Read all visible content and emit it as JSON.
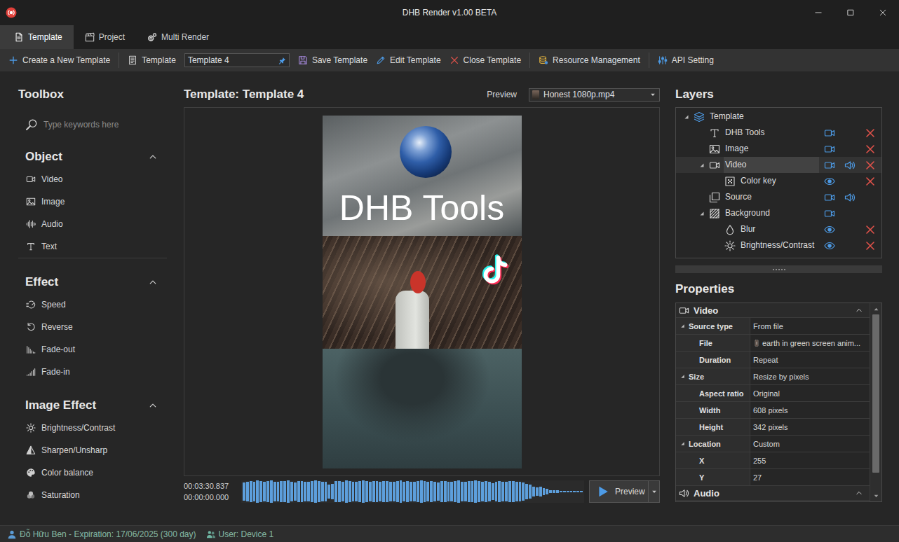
{
  "window": {
    "title": "DHB Render v1.00 BETA"
  },
  "tabs": [
    {
      "label": "Template",
      "selected": true
    },
    {
      "label": "Project",
      "selected": false
    },
    {
      "label": "Multi Render",
      "selected": false
    }
  ],
  "toolbar": {
    "create_button": "Create a New Template",
    "template_label": "Template",
    "template_field": "Template 4",
    "save_button": "Save Template",
    "edit_button": "Edit Template",
    "close_button": "Close Template",
    "resource_button": "Resource Management",
    "api_button": "API Setting"
  },
  "toolbox": {
    "title": "Toolbox",
    "search_placeholder": "Type keywords here",
    "sections": [
      {
        "title": "Object",
        "expanded": true,
        "items": [
          "Video",
          "Image",
          "Audio",
          "Text"
        ]
      },
      {
        "title": "Effect",
        "expanded": true,
        "items": [
          "Speed",
          "Reverse",
          "Fade-out",
          "Fade-in"
        ]
      },
      {
        "title": "Image Effect",
        "expanded": true,
        "items": [
          "Brightness/Contrast",
          "Sharpen/Unsharp",
          "Color balance",
          "Saturation"
        ]
      }
    ]
  },
  "editor": {
    "title": "Template: Template 4",
    "preview_label": "Preview",
    "preview_source": "Honest 1080p.mp4",
    "canvas_text": "DHB Tools",
    "time_total": "00:03:30.837",
    "time_current": "00:00:00.000",
    "waveform": [
      0.82,
      0.9,
      0.95,
      0.88,
      0.97,
      0.92,
      0.85,
      0.93,
      0.99,
      0.9,
      0.86,
      0.94,
      0.91,
      0.97,
      0.89,
      0.84,
      0.92,
      0.96,
      0.9,
      0.87,
      0.93,
      0.98,
      0.91,
      0.85,
      0.9,
      0.62,
      0.7,
      0.95,
      0.92,
      0.88,
      0.97,
      0.93,
      0.9,
      0.86,
      0.94,
      0.99,
      0.91,
      0.88,
      0.95,
      0.92,
      0.87,
      0.93,
      0.96,
      0.9,
      0.85,
      0.92,
      0.97,
      0.89,
      0.94,
      0.9,
      0.86,
      0.93,
      0.98,
      0.91,
      0.88,
      0.95,
      0.9,
      0.84,
      0.92,
      0.96,
      0.9,
      0.87,
      0.93,
      0.97,
      0.9,
      0.86,
      0.94,
      0.91,
      0.98,
      0.92,
      0.88,
      0.95,
      0.9,
      0.72,
      0.85,
      0.93,
      0.9,
      0.87,
      0.94,
      0.96,
      0.9,
      0.85,
      0.8,
      0.7,
      0.6,
      0.45,
      0.38,
      0.42,
      0.3,
      0.25,
      0.15,
      0.12,
      0.1,
      0.05,
      0.04,
      0.04,
      0.04,
      0.04,
      0.04,
      0.04
    ],
    "preview_button": "Preview"
  },
  "layers": {
    "title": "Layers",
    "rows": [
      {
        "label": "Template",
        "depth": 0,
        "kind": "root",
        "has_children": true,
        "expanded": true,
        "selected": false,
        "audio": false,
        "removable": false
      },
      {
        "label": "DHB Tools",
        "depth": 1,
        "kind": "layer",
        "has_children": false,
        "expanded": false,
        "selected": false,
        "audio": false,
        "removable": true
      },
      {
        "label": "Image",
        "depth": 1,
        "kind": "layer",
        "has_children": false,
        "expanded": false,
        "selected": false,
        "audio": false,
        "removable": true
      },
      {
        "label": "Video",
        "depth": 1,
        "kind": "layer",
        "has_children": true,
        "expanded": true,
        "selected": true,
        "audio": true,
        "removable": true
      },
      {
        "label": "Color key",
        "depth": 2,
        "kind": "effect",
        "has_children": false,
        "expanded": false,
        "selected": false,
        "audio": false,
        "removable": true
      },
      {
        "label": "Source",
        "depth": 1,
        "kind": "layer",
        "has_children": false,
        "expanded": false,
        "selected": false,
        "audio": true,
        "removable": false
      },
      {
        "label": "Background",
        "depth": 1,
        "kind": "layer",
        "has_children": true,
        "expanded": true,
        "selected": false,
        "audio": false,
        "removable": false
      },
      {
        "label": "Blur",
        "depth": 2,
        "kind": "effect",
        "has_children": false,
        "expanded": false,
        "selected": false,
        "audio": false,
        "removable": true
      },
      {
        "label": "Brightness/Contrast",
        "depth": 2,
        "kind": "effect",
        "has_children": false,
        "expanded": false,
        "selected": false,
        "audio": false,
        "removable": true
      }
    ]
  },
  "properties": {
    "title": "Properties",
    "sections": [
      {
        "title": "Video",
        "expanded": true,
        "rows": [
          {
            "label": "Source type",
            "value": "From file",
            "kind": "category",
            "expanded": true
          },
          {
            "label": "File",
            "value": "earth in green screen anim...",
            "kind": "file",
            "expanded": false
          },
          {
            "label": "Duration",
            "value": "Repeat",
            "kind": "property",
            "expanded": false
          },
          {
            "label": "Size",
            "value": "Resize by pixels",
            "kind": "category",
            "expanded": true
          },
          {
            "label": "Aspect ratio",
            "value": "Original",
            "kind": "property",
            "expanded": false
          },
          {
            "label": "Width",
            "value": "608 pixels",
            "kind": "property",
            "expanded": false
          },
          {
            "label": "Height",
            "value": "342 pixels",
            "kind": "property",
            "expanded": false
          },
          {
            "label": "Location",
            "value": "Custom",
            "kind": "category",
            "expanded": true
          },
          {
            "label": "X",
            "value": "255",
            "kind": "property",
            "expanded": false
          },
          {
            "label": "Y",
            "value": "27",
            "kind": "property",
            "expanded": false
          }
        ]
      },
      {
        "title": "Audio",
        "expanded": true,
        "rows": []
      }
    ],
    "scrollbar": {
      "level": 0.9
    }
  },
  "status_bar": {
    "license": "Đỗ Hữu Ben - Expiration: 17/06/2025 (300 day)",
    "user": "User: Device 1"
  }
}
